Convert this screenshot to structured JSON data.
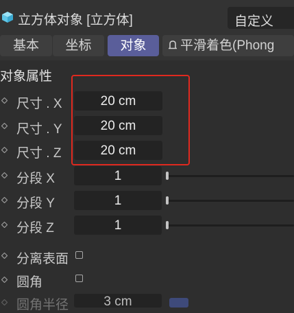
{
  "header": {
    "icon": "cube-icon",
    "title": "立方体对象 [立方体]",
    "mode_select": "自定义"
  },
  "tabs": [
    {
      "label": "基本",
      "active": false
    },
    {
      "label": "坐标",
      "active": false
    },
    {
      "label": "对象",
      "active": true
    },
    {
      "label": "平滑着色(Phong",
      "active": false,
      "icon": "bell-icon"
    }
  ],
  "section_title": "对象属性",
  "size_fields": [
    {
      "label": "尺寸 . X",
      "value": "20 cm"
    },
    {
      "label": "尺寸 . Y",
      "value": "20 cm"
    },
    {
      "label": "尺寸 . Z",
      "value": "20 cm"
    }
  ],
  "segment_fields": [
    {
      "label": "分段 X",
      "value": "1"
    },
    {
      "label": "分段 Y",
      "value": "1"
    },
    {
      "label": "分段 Z",
      "value": "1"
    }
  ],
  "checkboxes": [
    {
      "label": "分离表面",
      "checked": false
    },
    {
      "label": "圆角",
      "checked": false
    }
  ],
  "fillet_radius": {
    "label": "圆角半径",
    "value": "3 cm"
  },
  "colors": {
    "highlight": "#e0291f",
    "active_tab": "#5a5e9a",
    "cube_icon": "#7fd6f0"
  }
}
